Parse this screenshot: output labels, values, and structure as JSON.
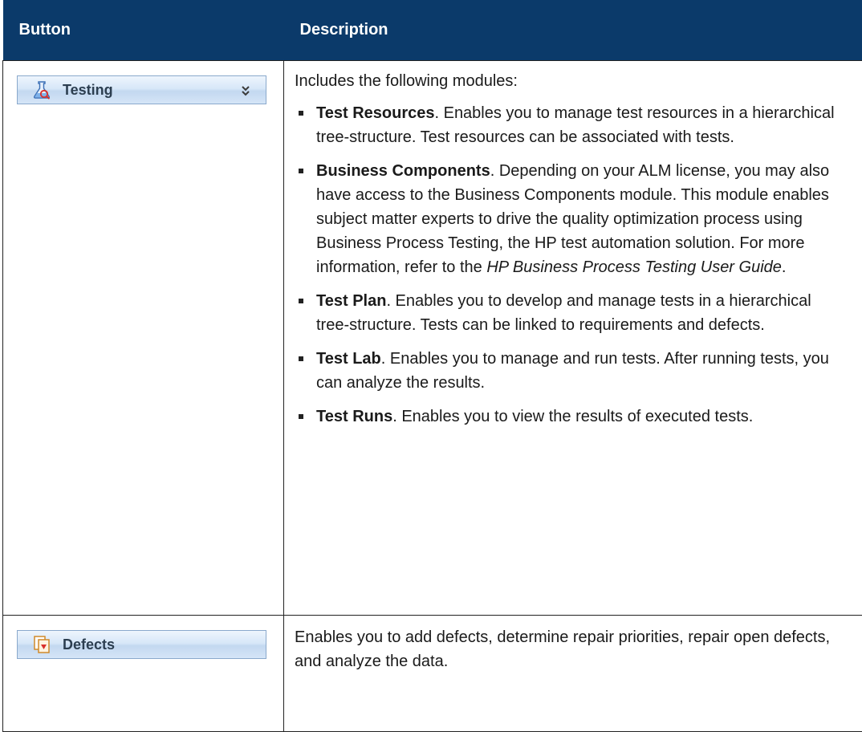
{
  "header": {
    "col_button": "Button",
    "col_description": "Description"
  },
  "rows": [
    {
      "button": {
        "label": "Testing",
        "icon": "flask-icon",
        "trailing_icon": "double-chevron-down-icon"
      },
      "intro": "Includes the following modules:",
      "items": [
        {
          "term": "Test Resources",
          "text": ". Enables you to manage test resources in a hierarchical tree-structure. Test resources can be associated with tests."
        },
        {
          "term": "Business Components",
          "text": ". Depending on your ALM license, you may also have access to the Business Components module. This module enables subject matter experts to drive the quality optimization process using Business Process Testing, the HP test automation solution. For more information, refer to the ",
          "ref": "HP Business Process Testing User Guide",
          "tail": "."
        },
        {
          "term": "Test Plan",
          "text": ". Enables you to develop and manage tests in a hierarchical tree-structure. Tests can be linked to requirements and defects."
        },
        {
          "term": "Test Lab",
          "text": ". Enables you to manage and run tests. After running tests, you can analyze the results."
        },
        {
          "term": "Test Runs",
          "text": ". Enables you to view the results of executed tests."
        }
      ]
    },
    {
      "button": {
        "label": "Defects",
        "icon": "defects-icon"
      },
      "description": "Enables you to add defects, determine repair priorities, repair open defects, and analyze the data."
    }
  ]
}
